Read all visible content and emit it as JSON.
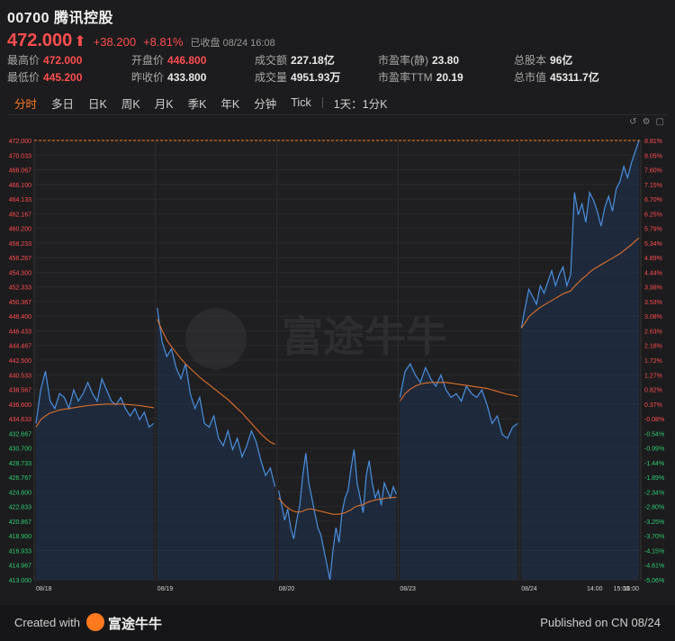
{
  "header": {
    "code": "00700",
    "name": "腾讯控股",
    "price": "472.000",
    "change": "+38.200",
    "change_pct": "+8.81%",
    "status": "已收盘 08/24 16:08"
  },
  "stats": [
    {
      "label": "最高价",
      "value": "472.000",
      "up": true
    },
    {
      "label": "最低价",
      "value": "445.200",
      "up": true
    },
    {
      "label": "开盘价",
      "value": "446.800",
      "up": true
    },
    {
      "label": "昨收价",
      "value": "433.800",
      "up": false
    },
    {
      "label": "成交额",
      "value": "227.18亿",
      "up": false
    },
    {
      "label": "成交量",
      "value": "4951.93万",
      "up": false
    },
    {
      "label": "市盈率(静)",
      "value": "23.80",
      "up": false
    },
    {
      "label": "市盈率TTM",
      "value": "20.19",
      "up": false
    },
    {
      "label": "总股本",
      "value": "96亿",
      "up": false
    },
    {
      "label": "总市值",
      "value": "45311.7亿",
      "up": false
    }
  ],
  "tabs": [
    "分时",
    "多日",
    "日K",
    "周K",
    "月K",
    "季K",
    "年K",
    "分钟",
    "Tick",
    "1天：1分K"
  ],
  "toolbar_icons": [
    "undo-icon",
    "settings-icon",
    "expand-icon"
  ],
  "colors": {
    "up": "#ff4d4f",
    "down": "#2ecc71",
    "accent": "#ff7a1f",
    "price_line": "#4a8fe0",
    "avg_line": "#e0702a"
  },
  "watermark": "富途牛牛",
  "footer": {
    "created": "Created with",
    "brand": "富途牛牛",
    "published": "Published on CN 08/24"
  },
  "chart_data": {
    "type": "line",
    "prev_close": 433.8,
    "ylim": [
      413.0,
      472.0
    ],
    "y_ticks_left": [
      "472.000",
      "470.033",
      "468.067",
      "466.100",
      "464.133",
      "462.167",
      "460.200",
      "458.233",
      "456.267",
      "454.300",
      "452.333",
      "450.367",
      "448.400",
      "446.433",
      "444.467",
      "442.500",
      "440.533",
      "438.567",
      "436.600",
      "434.633",
      "432.667",
      "430.700",
      "428.733",
      "426.767",
      "424.800",
      "422.833",
      "420.867",
      "418.900",
      "416.933",
      "414.967",
      "413.000"
    ],
    "y_ticks_right": [
      "8.81%",
      "8.05%",
      "7.60%",
      "7.15%",
      "6.70%",
      "6.25%",
      "5.79%",
      "5.34%",
      "4.89%",
      "4.44%",
      "3.98%",
      "3.53%",
      "3.08%",
      "2.63%",
      "2.18%",
      "1.72%",
      "1.27%",
      "0.82%",
      "0.37%",
      "-0.08%",
      "-0.54%",
      "-0.99%",
      "-1.44%",
      "-1.89%",
      "-2.34%",
      "-2.80%",
      "-3.25%",
      "-3.70%",
      "-4.15%",
      "-4.61%",
      "-5.06%"
    ],
    "x_labels": [
      "08/18",
      "08/19",
      "08/20",
      "08/23",
      "08/24",
      "14:00",
      "15:00",
      "16:00"
    ],
    "days": [
      {
        "label": "08/18",
        "price": [
          434.0,
          438.5,
          441.0,
          437.0,
          436.0,
          438.0,
          437.5,
          436.0,
          438.5,
          437.0,
          438.0,
          439.5,
          438.0,
          437.0,
          440.0,
          438.5,
          437.0,
          436.5,
          437.5,
          436.0,
          435.0,
          436.0,
          434.5,
          435.5,
          433.5,
          434.0
        ],
        "avg": [
          433.5,
          434.5,
          435.0,
          435.4,
          435.6,
          435.8,
          435.9,
          436.0,
          436.1,
          436.2,
          436.3,
          436.4,
          436.45,
          436.5,
          436.55,
          436.6,
          436.6,
          436.6,
          436.6,
          436.55,
          436.5,
          436.45,
          436.4,
          436.3,
          436.2,
          436.1
        ]
      },
      {
        "label": "08/19",
        "price": [
          449.5,
          445.0,
          443.0,
          444.0,
          441.5,
          440.0,
          442.0,
          438.0,
          436.0,
          437.5,
          434.0,
          433.5,
          435.0,
          432.0,
          431.0,
          433.0,
          430.5,
          432.0,
          429.5,
          431.0,
          433.0,
          431.5,
          429.0,
          427.0,
          428.0,
          425.5
        ],
        "avg": [
          448.0,
          446.5,
          445.2,
          444.3,
          443.5,
          442.7,
          442.0,
          441.4,
          440.8,
          440.2,
          439.7,
          439.2,
          438.7,
          438.2,
          437.7,
          437.2,
          436.6,
          436.0,
          435.4,
          434.7,
          434.0,
          433.3,
          432.6,
          432.0,
          431.5,
          431.2
        ]
      },
      {
        "label": "08/20",
        "price": [
          425.0,
          423.0,
          421.0,
          422.5,
          420.0,
          418.5,
          421.0,
          423.0,
          427.0,
          430.0,
          426.0,
          424.0,
          422.0,
          420.0,
          419.0,
          417.0,
          415.0,
          413.0,
          417.0,
          420.0,
          418.0,
          422.0,
          424.0,
          425.0,
          428.0,
          430.5,
          426.0,
          424.0,
          422.0,
          427.0,
          429.0,
          426.0,
          424.0,
          425.0,
          423.0,
          426.0,
          425.0,
          424.0,
          425.5,
          424.5
        ],
        "avg": [
          424.0,
          423.5,
          423.0,
          422.7,
          422.4,
          422.2,
          422.1,
          422.1,
          422.2,
          422.4,
          422.5,
          422.5,
          422.4,
          422.3,
          422.2,
          422.1,
          422.0,
          421.9,
          421.8,
          421.8,
          421.8,
          421.9,
          422.0,
          422.2,
          422.4,
          422.7,
          422.9,
          423.0,
          423.1,
          423.3,
          423.5,
          423.6,
          423.7,
          423.8,
          423.85,
          423.9,
          424.0,
          424.0,
          424.05,
          424.1
        ]
      },
      {
        "label": "08/23",
        "price": [
          437.5,
          441.0,
          442.0,
          440.5,
          439.5,
          441.5,
          440.0,
          439.0,
          440.5,
          438.5,
          437.5,
          438.0,
          437.0,
          439.0,
          438.0,
          437.5,
          438.5,
          436.5,
          434.0,
          435.0,
          432.5,
          432.0,
          433.5,
          434.0
        ],
        "avg": [
          437.0,
          438.0,
          438.6,
          439.0,
          439.3,
          439.4,
          439.5,
          439.5,
          439.5,
          439.5,
          439.4,
          439.3,
          439.2,
          439.1,
          439.0,
          438.9,
          438.8,
          438.7,
          438.5,
          438.3,
          438.1,
          437.9,
          437.8,
          437.6
        ]
      },
      {
        "label": "08/24",
        "price": [
          446.8,
          449.5,
          452.0,
          451.0,
          450.0,
          452.5,
          451.5,
          453.0,
          454.5,
          452.5,
          454.0,
          455.0,
          452.5,
          454.0,
          465.0,
          462.0,
          463.5,
          461.0,
          465.0,
          464.0,
          462.5,
          460.5,
          463.0,
          464.5,
          462.5,
          465.5,
          466.5,
          468.5,
          467.0,
          469.0,
          470.5,
          472.0
        ],
        "avg": [
          446.8,
          447.5,
          448.3,
          448.8,
          449.2,
          449.6,
          449.9,
          450.2,
          450.5,
          450.8,
          451.1,
          451.4,
          451.6,
          451.8,
          452.4,
          452.9,
          453.4,
          453.8,
          454.3,
          454.7,
          455.0,
          455.3,
          455.6,
          455.9,
          456.2,
          456.5,
          456.8,
          457.2,
          457.6,
          458.0,
          458.5,
          458.9
        ]
      }
    ]
  }
}
